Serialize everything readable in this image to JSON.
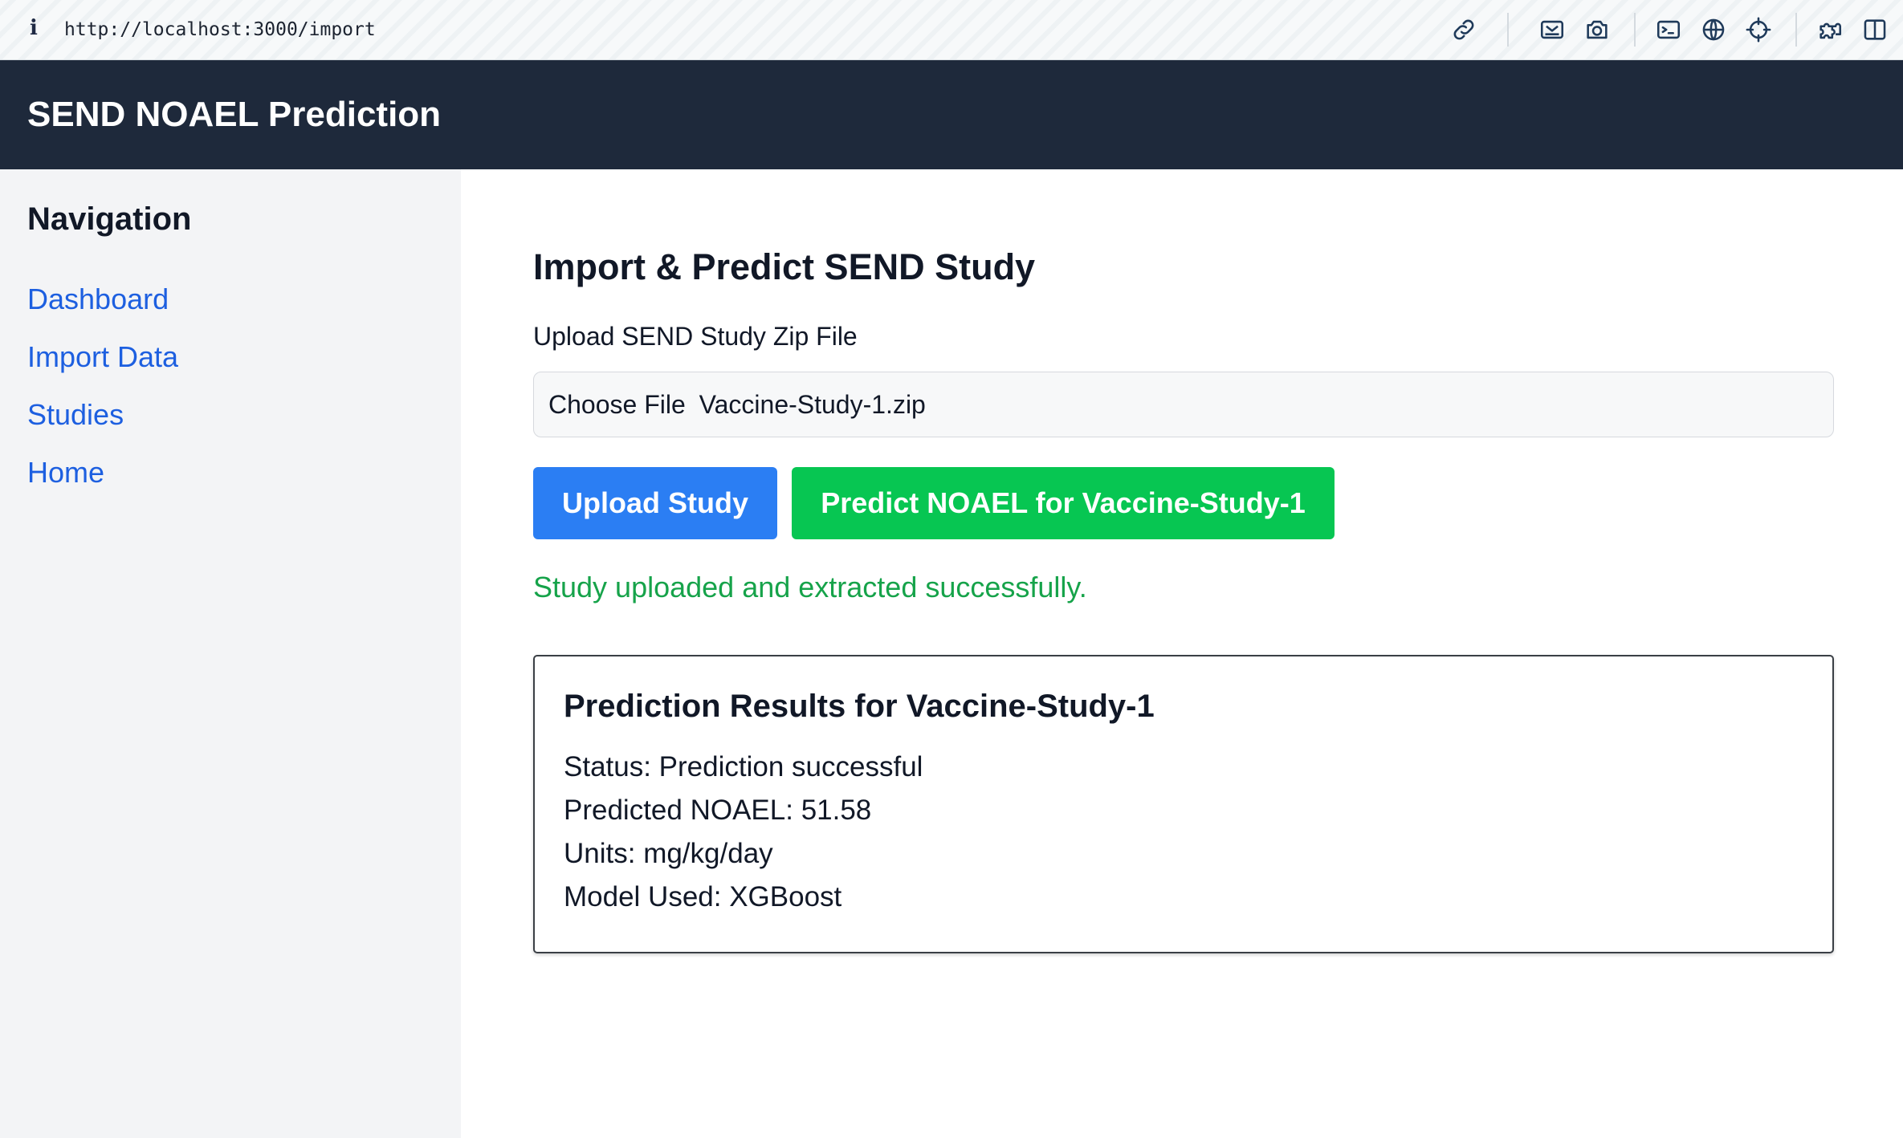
{
  "browser": {
    "url": "http://localhost:3000/import",
    "info_glyph": "i",
    "toolbar_icons": [
      "link-icon",
      "image-capture-icon",
      "camera-icon",
      "terminal-icon",
      "globe-icon",
      "crosshair-icon",
      "puzzle-icon",
      "sidebar-toggle-icon"
    ]
  },
  "app": {
    "title": "SEND NOAEL Prediction"
  },
  "sidebar": {
    "heading": "Navigation",
    "items": [
      {
        "label": "Dashboard"
      },
      {
        "label": "Import Data"
      },
      {
        "label": "Studies"
      },
      {
        "label": "Home"
      }
    ]
  },
  "main": {
    "title": "Import & Predict SEND Study",
    "upload_label": "Upload SEND Study Zip File",
    "file_input": {
      "button_text": "Choose File",
      "file_name": "Vaccine-Study-1.zip"
    },
    "upload_button": "Upload Study",
    "predict_button": "Predict NOAEL for Vaccine-Study-1",
    "success_message": "Study uploaded and extracted successfully.",
    "results": {
      "title": "Prediction Results for Vaccine-Study-1",
      "status": "Status: Prediction successful",
      "noael": "Predicted NOAEL: 51.58",
      "units": "Units: mg/kg/day",
      "model": "Model Used: XGBoost"
    }
  },
  "colors": {
    "header_bg": "#1e293b",
    "sidebar_bg": "#f3f4f6",
    "link": "#1d5fe0",
    "upload_button": "#2b7ef3",
    "predict_button": "#07c652",
    "success_text": "#16a34a"
  }
}
